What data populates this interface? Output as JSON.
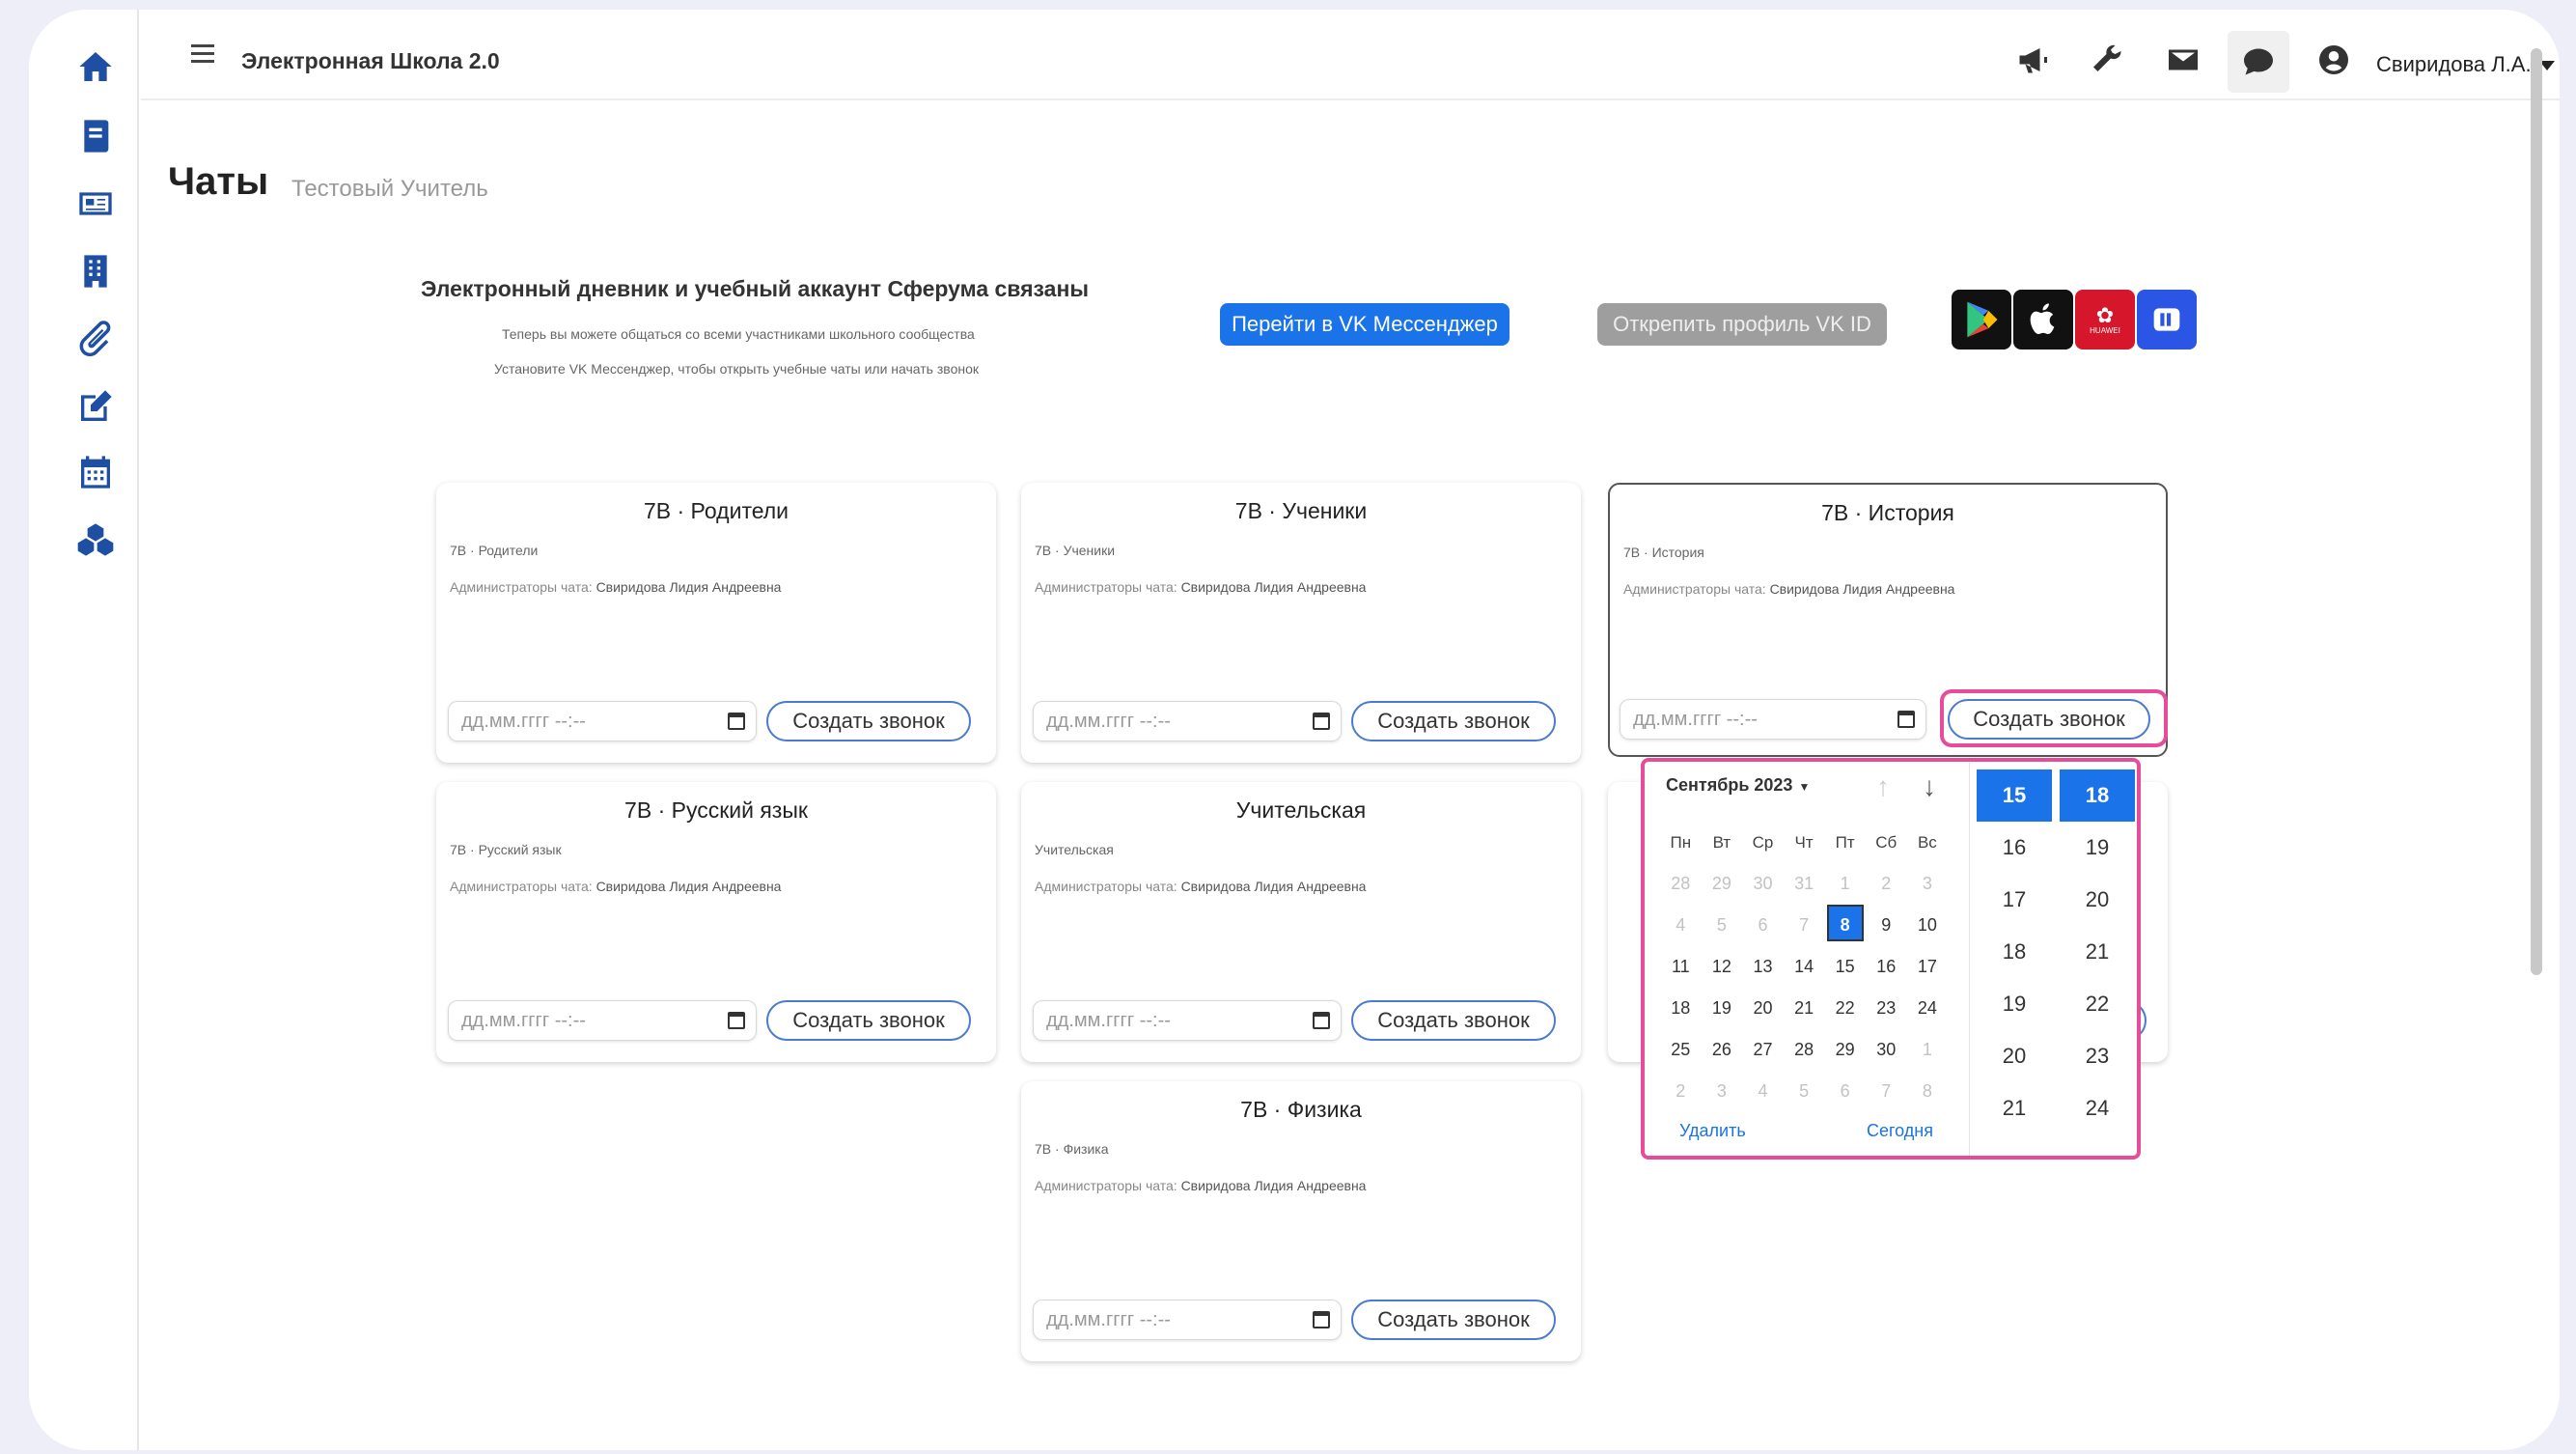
{
  "app": {
    "title": "Электронная Школа 2.0",
    "user": "Свиридова Л.А."
  },
  "page": {
    "title": "Чаты",
    "subtitle": "Тестовый Учитель"
  },
  "banner": {
    "title": "Электронный дневник и учебный аккаунт Сферума связаны",
    "line1": "Теперь вы можете общаться со всеми участниками школьного сообщества",
    "line2": "Установите VK Мессенджер, чтобы открыть учебные чаты или начать звонок",
    "btn_messenger": "Перейти в VK Мессенджер",
    "btn_unlink": "Открепить профиль VK ID",
    "store_huawei": "HUAWEI"
  },
  "cards": [
    {
      "title": "7В · Родители",
      "sub": "7В · Родители",
      "admins_label": "Администраторы чата:",
      "admins": "Свиридова Лидия Андреевна",
      "placeholder": "дд.мм.гггг --:--",
      "button": "Создать звонок"
    },
    {
      "title": "7В · Ученики",
      "sub": "7В · Ученики",
      "admins_label": "Администраторы чата:",
      "admins": "Свиридова Лидия Андреевна",
      "placeholder": "дд.мм.гггг --:--",
      "button": "Создать звонок"
    },
    {
      "title": "7В · История",
      "sub": "7В · История",
      "admins_label": "Администраторы чата:",
      "admins": "Свиридова Лидия Андреевна",
      "placeholder": "дд.мм.гггг --:--",
      "button": "Создать звонок"
    },
    {
      "title": "7В · Русский язык",
      "sub": "7В · Русский язык",
      "admins_label": "Администраторы чата:",
      "admins": "Свиридова Лидия Андреевна",
      "placeholder": "дд.мм.гггг --:--",
      "button": "Создать звонок"
    },
    {
      "title": "Учительская",
      "sub": "Учительская",
      "admins_label": "Администраторы чата:",
      "admins": "Свиридова Лидия Андреевна",
      "placeholder": "дд.мм.гггг --:--",
      "button": "Создать звонок"
    },
    {
      "title": "7В · Физика",
      "sub": "7В · Физика",
      "admins_label": "Администраторы чата:",
      "admins": "Свиридова Лидия Андреевна",
      "placeholder": "дд.мм.гггг --:--",
      "button": "Создать звонок"
    }
  ],
  "picker": {
    "month": "Сентябрь 2023",
    "weekdays": [
      "Пн",
      "Вт",
      "Ср",
      "Чт",
      "Пт",
      "Сб",
      "Вс"
    ],
    "weeks": [
      [
        "28",
        "29",
        "30",
        "31",
        "1",
        "2",
        "3"
      ],
      [
        "4",
        "5",
        "6",
        "7",
        "8",
        "9",
        "10"
      ],
      [
        "11",
        "12",
        "13",
        "14",
        "15",
        "16",
        "17"
      ],
      [
        "18",
        "19",
        "20",
        "21",
        "22",
        "23",
        "24"
      ],
      [
        "25",
        "26",
        "27",
        "28",
        "29",
        "30",
        "1"
      ],
      [
        "2",
        "3",
        "4",
        "5",
        "6",
        "7",
        "8"
      ]
    ],
    "today": "8",
    "clear": "Удалить",
    "today_label": "Сегодня",
    "hours": [
      "15",
      "16",
      "17",
      "18",
      "19",
      "20",
      "21"
    ],
    "minutes": [
      "18",
      "19",
      "20",
      "21",
      "22",
      "23",
      "24"
    ],
    "selected_hour": "15",
    "selected_minute": "18"
  },
  "hidden_card_button_fragment": "ок"
}
